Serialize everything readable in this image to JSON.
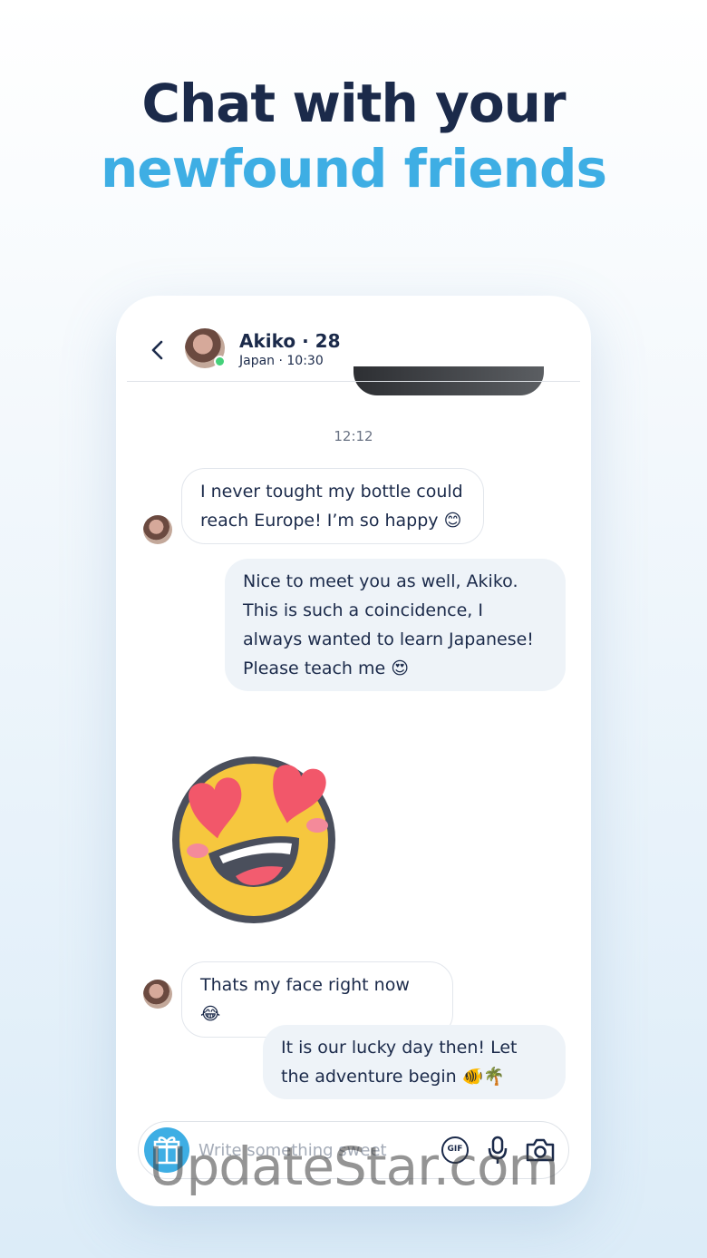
{
  "headline": {
    "line1": "Chat with your",
    "line2": "newfound friends"
  },
  "chat": {
    "contact_name": "Akiko · 28",
    "contact_sub": "Japan · 10:30",
    "timestamp": "12:12",
    "messages": [
      {
        "from": "them",
        "text": "I never tought my bottle could reach Europe! I’m so happy 😊"
      },
      {
        "from": "me",
        "text": "Nice to meet you as well, Akiko. This is such a coincidence, I always wanted to learn Japanese! Please teach me 😍"
      },
      {
        "from": "them",
        "text": "Thats my face right now 😂"
      },
      {
        "from": "me",
        "text": "It is our lucky day then! Let the adventure begin 🐠🌴"
      }
    ],
    "sticker": "heart-eyes-sticker"
  },
  "composer": {
    "placeholder": "Write something sweet",
    "gif_label": "GIF"
  },
  "watermark": "UpdateStar.com",
  "colors": {
    "navy": "#1b2a4a",
    "accent": "#3eaee4",
    "online": "#44d17a"
  }
}
